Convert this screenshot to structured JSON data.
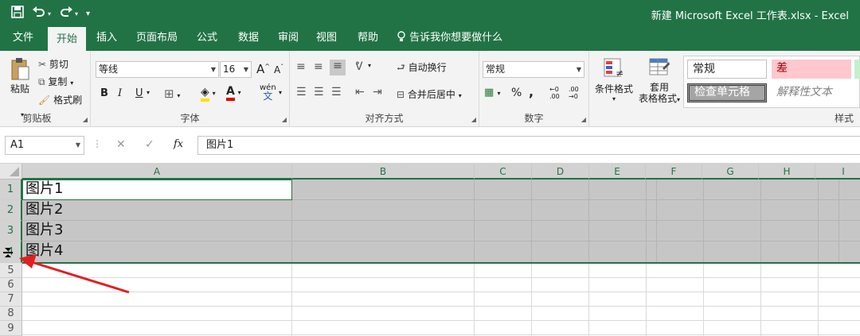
{
  "qat": {
    "save_icon": "save-icon",
    "undo_icon": "undo-icon",
    "redo_icon": "redo-icon",
    "customize_icon": "customize-qat-icon"
  },
  "window_title": "新建 Microsoft Excel 工作表.xlsx  -  Excel",
  "tabs": [
    "文件",
    "开始",
    "插入",
    "页面布局",
    "公式",
    "数据",
    "审阅",
    "视图",
    "帮助"
  ],
  "tell_me": "告诉我你想要做什么",
  "clipboard": {
    "paste": "粘贴",
    "cut": "剪切",
    "copy": "复制",
    "format_painter": "格式刷",
    "label": "剪贴板"
  },
  "font": {
    "name": "等线",
    "size": "16",
    "bold": "B",
    "italic": "I",
    "underline": "U",
    "phonetic": "wén",
    "label": "字体",
    "grow": "A",
    "shrink": "A"
  },
  "alignment": {
    "wrap": "自动换行",
    "merge": "合并后居中",
    "label": "对齐方式"
  },
  "number": {
    "format": "常规",
    "percent": "%",
    "comma": ",",
    "label": "数字"
  },
  "styles_group": {
    "conditional": "条件格式",
    "table_format_1": "套用",
    "table_format_2": "表格格式",
    "normal": "常规",
    "bad": "差",
    "check_cell": "检查单元格",
    "explanatory": "解释性文本",
    "label": "样式"
  },
  "namebox": "A1",
  "formula_icons": {
    "cancel": "✕",
    "enter": "✓",
    "fx": "fx"
  },
  "formula": "图片1",
  "columns": [
    "A",
    "B",
    "C",
    "D",
    "E",
    "F",
    "G",
    "H",
    "I"
  ],
  "rows": [
    "1",
    "2",
    "3",
    "4",
    "5",
    "6",
    "7",
    "8",
    "9"
  ],
  "cells": [
    "图片1",
    "图片2",
    "图片3",
    "图片4"
  ],
  "colors": {
    "accent": "#217346",
    "selection": "#c6c6c6",
    "arrow": "#e02020"
  }
}
